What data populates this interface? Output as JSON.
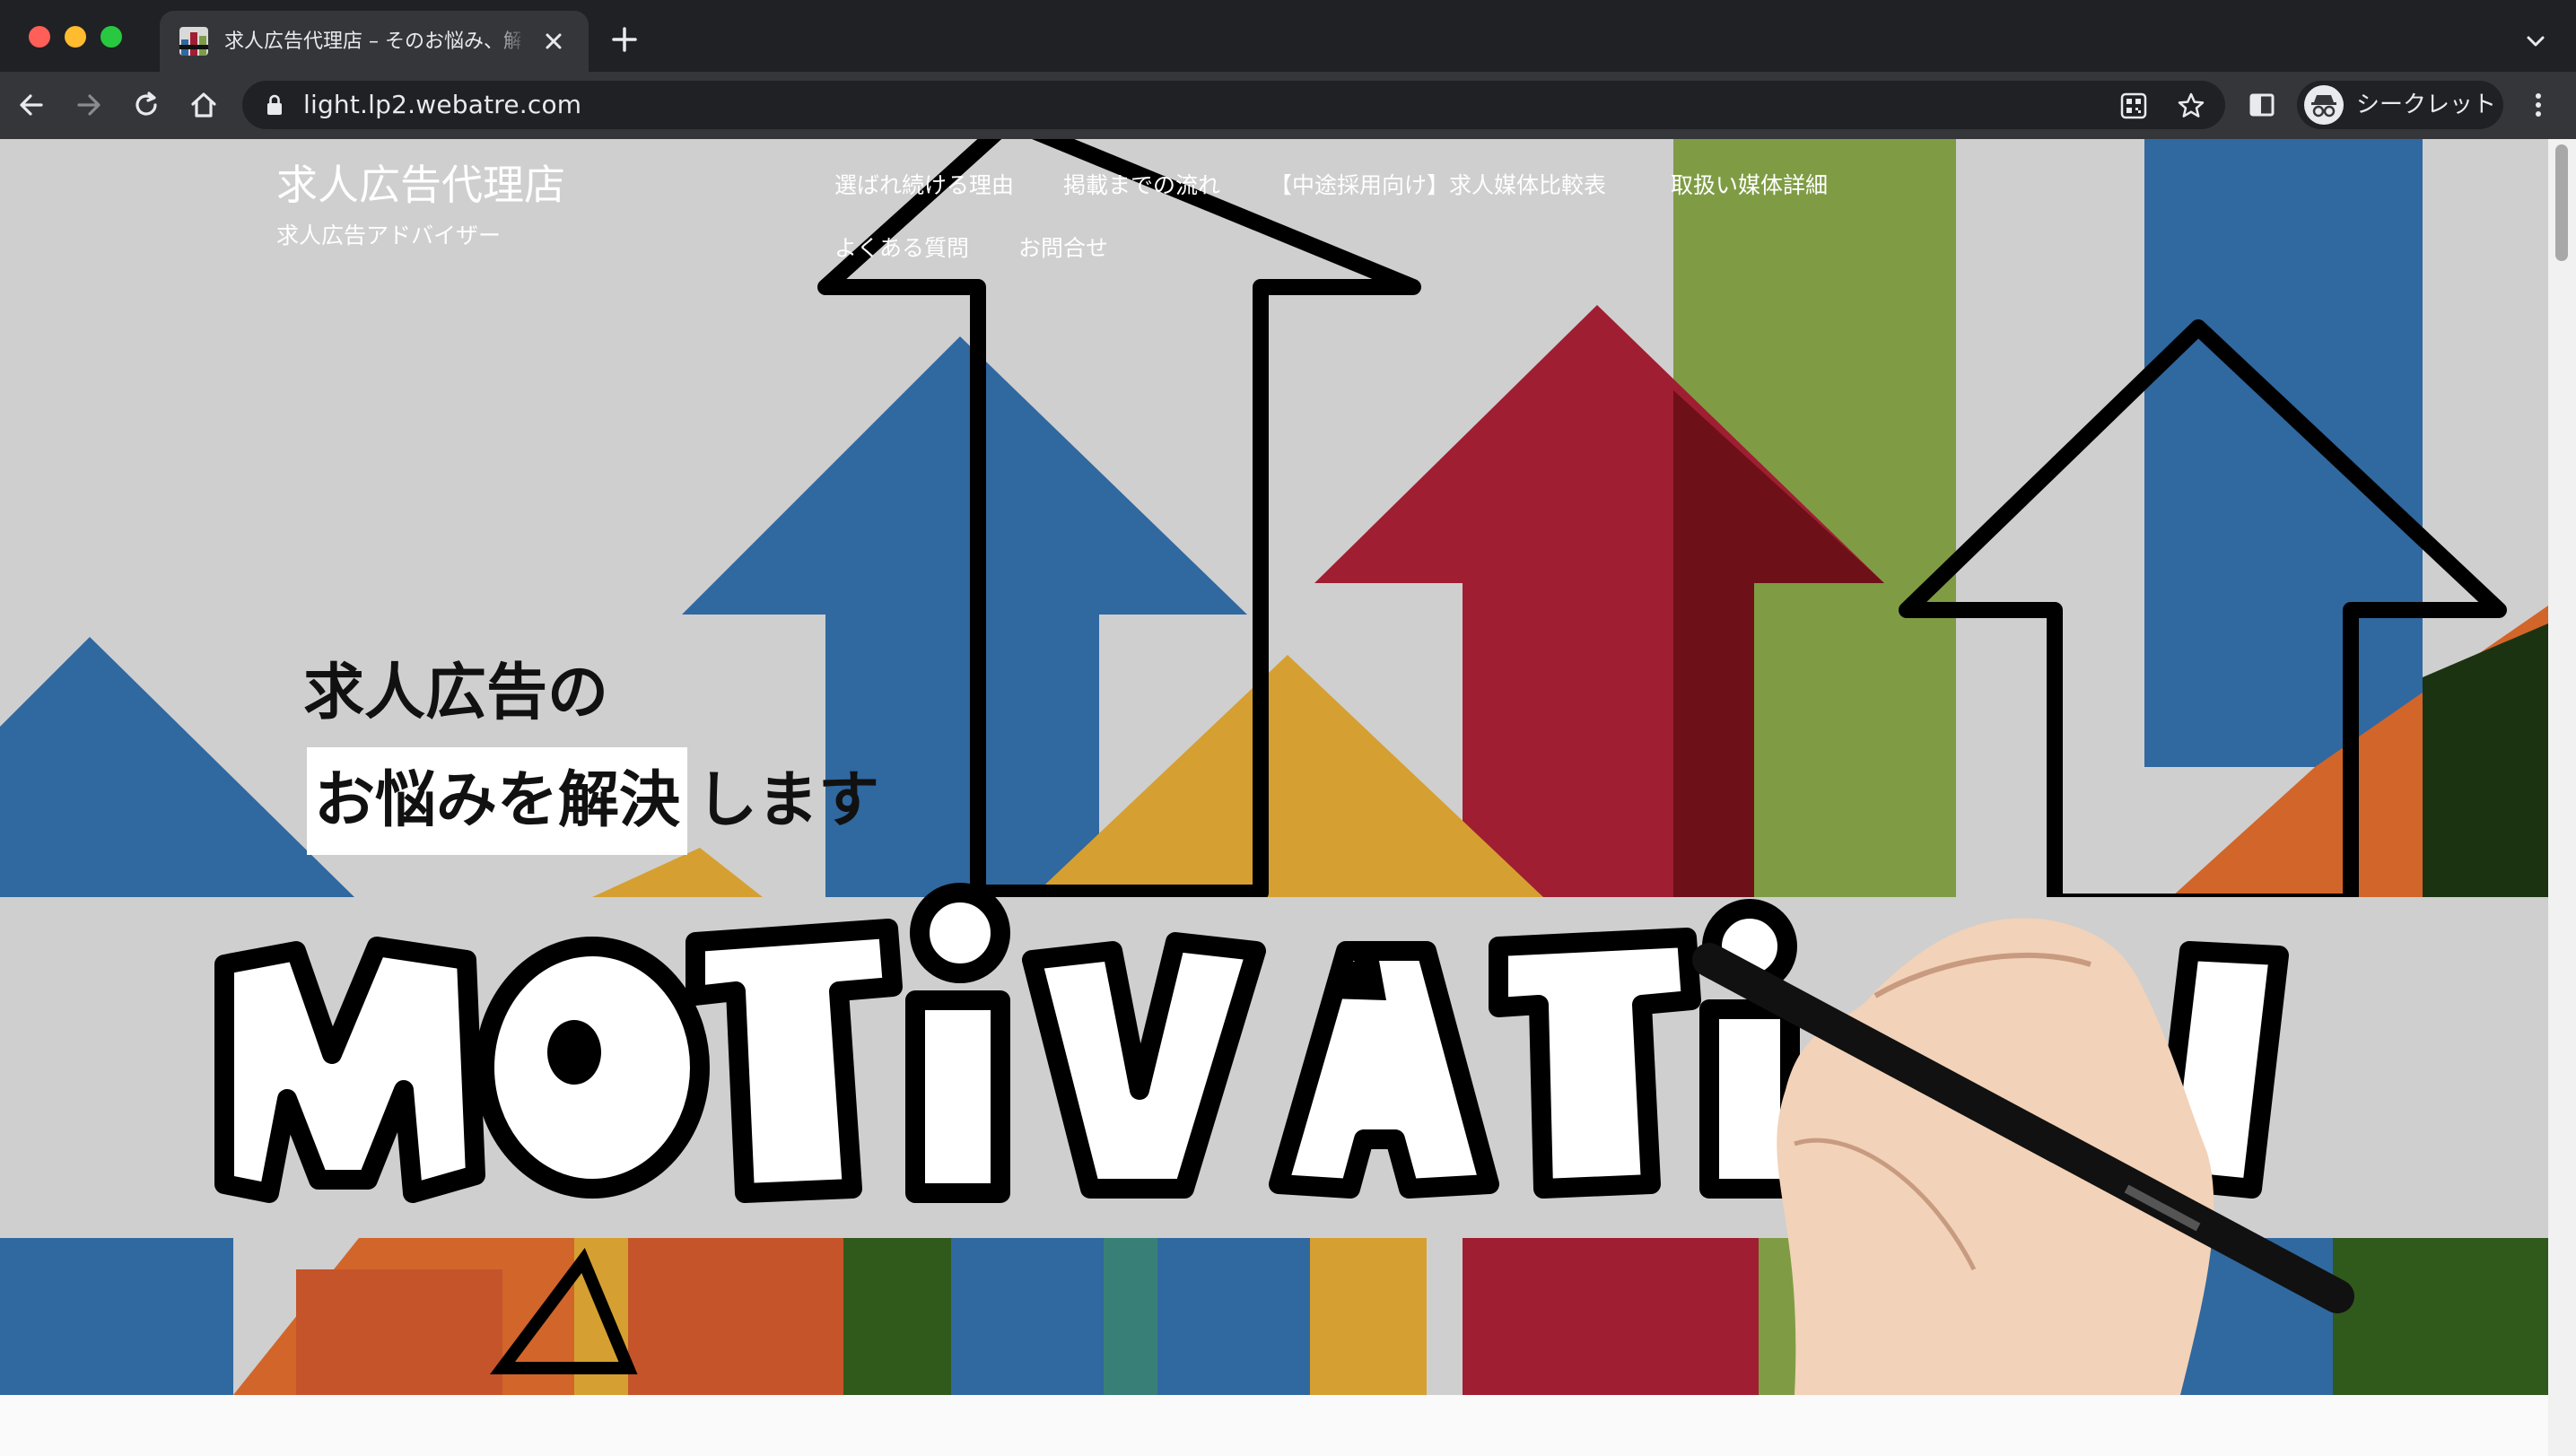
{
  "browser": {
    "tab": {
      "title": "求人広告代理店 – そのお悩み、解決"
    },
    "address_bar": {
      "url": "light.lp2.webatre.com"
    },
    "profile": {
      "label": "シークレット"
    }
  },
  "site": {
    "title": "求人広告代理店",
    "tagline": "求人広告アドバイザー",
    "nav": [
      "選ばれ続ける理由",
      "掲載までの流れ",
      "【中途採用向け】求人媒体比較表",
      "取扱い媒体詳細",
      "よくある質問",
      "お問合せ"
    ]
  },
  "hero": {
    "headline_line1": "求人広告の",
    "headline_highlight": "お悩みを解決",
    "headline_rest": "します"
  },
  "icons": {
    "nav": [
      "back-icon",
      "forward-icon",
      "reload-icon",
      "home-icon"
    ],
    "omnibox": [
      "lock-icon",
      "qr-code-icon",
      "bookmark-star-icon"
    ],
    "toolbar": [
      "side-panel-icon",
      "incognito-icon",
      "menu-icon"
    ]
  }
}
